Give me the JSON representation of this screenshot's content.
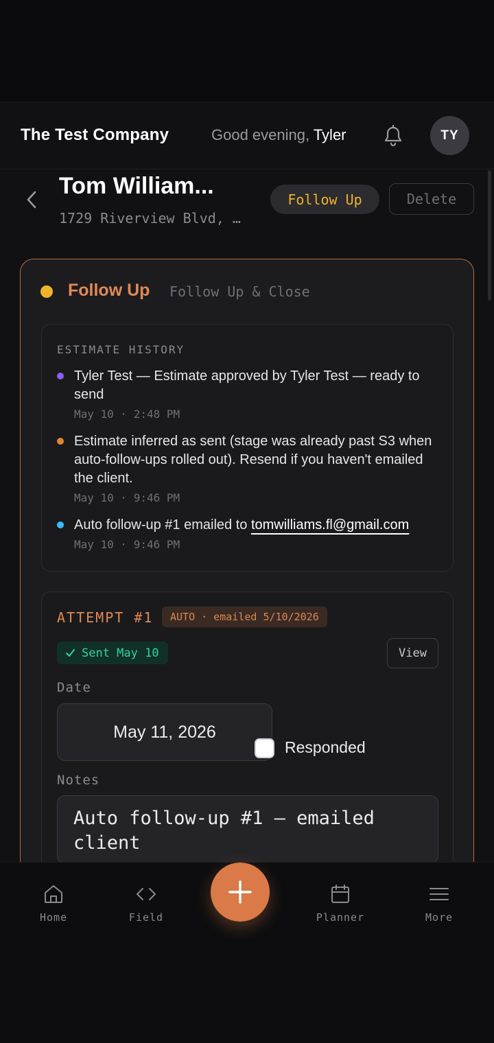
{
  "header": {
    "company": "The Test Company",
    "greeting_prefix": "Good evening,",
    "greeting_name": "Tyler",
    "avatar_initials": "TY"
  },
  "customer": {
    "name": "Tom William...",
    "address": "1729 Riverview Blvd, …",
    "follow_up_label": "Follow Up",
    "delete_label": "Delete"
  },
  "stage": {
    "title": "Follow Up",
    "subtitle": "Follow Up & Close",
    "dot_color": "#f0b429"
  },
  "history": {
    "title": "ESTIMATE HISTORY",
    "items": [
      {
        "text": "Tyler Test — Estimate approved by Tyler Test — ready to send",
        "time": "May 10 · 2:48 PM",
        "color": "#8b5cf6"
      },
      {
        "text": "Estimate inferred as sent (stage was already past S3 when auto-follow-ups rolled out). Resend if you haven't emailed the client.",
        "time": "May 10 · 9:46 PM",
        "color": "#e0872f"
      },
      {
        "text_prefix": "Auto follow-up #1 emailed to ",
        "email": "tomwilliams.fl@gmail.com",
        "time": "May 10 · 9:46 PM",
        "color": "#38bdf8"
      }
    ]
  },
  "attempt": {
    "title": "ATTEMPT #1",
    "auto_badge": "AUTO · emailed 5/10/2026",
    "sent_badge": "Sent May 10",
    "view_label": "View",
    "date_label": "Date",
    "date_value": "May 11, 2026",
    "responded_label": "Responded",
    "responded_checked": false,
    "notes_label": "Notes",
    "notes_value": "Auto follow-up #1 — emailed client"
  },
  "nav": {
    "home": "Home",
    "field": "Field",
    "planner": "Planner",
    "more": "More"
  },
  "colors": {
    "accent": "#d97a48",
    "stage_border": "#b86d42",
    "follow_up_text": "#f0b429",
    "sent_green": "#34d399"
  }
}
